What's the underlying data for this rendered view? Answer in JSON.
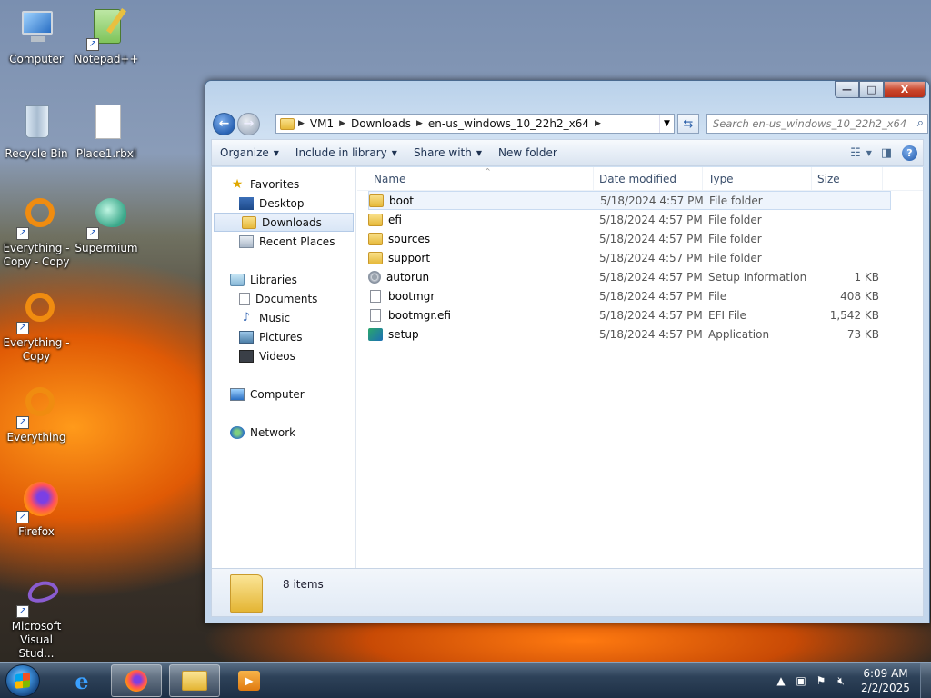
{
  "desktop": {
    "icons": [
      {
        "label": "Computer"
      },
      {
        "label": "Notepad++"
      },
      {
        "label": "Recycle Bin"
      },
      {
        "label": "Place1.rbxl"
      },
      {
        "label": "Everything -\nCopy - Copy"
      },
      {
        "label": "Supermium"
      },
      {
        "label": "Everything -\nCopy"
      },
      {
        "label": "Everything"
      },
      {
        "label": "Firefox"
      },
      {
        "label": "Microsoft\nVisual Stud..."
      }
    ]
  },
  "window": {
    "caption_buttons": {
      "minimize": "—",
      "maximize": "□",
      "close": "X"
    },
    "address": {
      "crumbs": [
        "VM1",
        "Downloads",
        "en-us_windows_10_22h2_x64"
      ]
    },
    "search_placeholder": "Search en-us_windows_10_22h2_x64",
    "toolbar": {
      "organize": "Organize",
      "include_in_library": "Include in library",
      "share_with": "Share with",
      "new_folder": "New folder"
    },
    "nav": {
      "favorites": "Favorites",
      "desktop": "Desktop",
      "downloads": "Downloads",
      "recent_places": "Recent Places",
      "libraries": "Libraries",
      "documents": "Documents",
      "music": "Music",
      "pictures": "Pictures",
      "videos": "Videos",
      "computer": "Computer",
      "network": "Network"
    },
    "columns": {
      "name": "Name",
      "date": "Date modified",
      "type": "Type",
      "size": "Size"
    },
    "files": [
      {
        "name": "boot",
        "date": "5/18/2024 4:57 PM",
        "type": "File folder",
        "size": "",
        "icon": "folder"
      },
      {
        "name": "efi",
        "date": "5/18/2024 4:57 PM",
        "type": "File folder",
        "size": "",
        "icon": "folder"
      },
      {
        "name": "sources",
        "date": "5/18/2024 4:57 PM",
        "type": "File folder",
        "size": "",
        "icon": "folder"
      },
      {
        "name": "support",
        "date": "5/18/2024 4:57 PM",
        "type": "File folder",
        "size": "",
        "icon": "folder"
      },
      {
        "name": "autorun",
        "date": "5/18/2024 4:57 PM",
        "type": "Setup Information",
        "size": "1 KB",
        "icon": "gear"
      },
      {
        "name": "bootmgr",
        "date": "5/18/2024 4:57 PM",
        "type": "File",
        "size": "408 KB",
        "icon": "doc"
      },
      {
        "name": "bootmgr.efi",
        "date": "5/18/2024 4:57 PM",
        "type": "EFI File",
        "size": "1,542 KB",
        "icon": "doc"
      },
      {
        "name": "setup",
        "date": "5/18/2024 4:57 PM",
        "type": "Application",
        "size": "73 KB",
        "icon": "app"
      }
    ],
    "details": {
      "items_count": "8 items"
    }
  },
  "taskbar": {
    "clock_time": "6:09 AM",
    "clock_date": "2/2/2025"
  }
}
